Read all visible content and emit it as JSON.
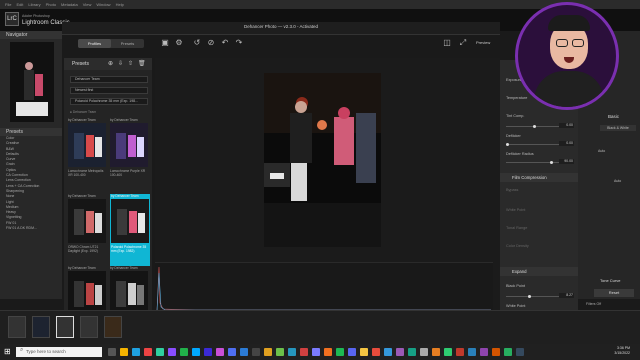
{
  "menubar": {
    "items": [
      "File",
      "Edit",
      "Library",
      "Photo",
      "Metadata",
      "View",
      "Window",
      "Help"
    ]
  },
  "app": {
    "name": "Lightroom Classic",
    "brand": "Adobe Photoshop",
    "logo": "LrC"
  },
  "left_panel": {
    "navigator_label": "Navigator",
    "presets_label": "Presets",
    "tree": [
      "Color",
      "Creative",
      "B&W",
      "Defaults",
      "Curve",
      "Grain",
      "Optics",
      "CA Correction",
      "Lens Correction",
      "Lens + CA Correction",
      "Sharpening",
      "None",
      "Light",
      "Medium",
      "Heavy",
      "Vignetting",
      "FW 01",
      "FW 01 A DK RDM..."
    ],
    "copy_label": "Copy...",
    "paste_label": "Paste"
  },
  "plugin": {
    "title": "Dehancer Photo — v2.3.0 - Activated",
    "tabs": [
      "Profiles",
      "Presets"
    ],
    "presets_header": "Presets",
    "filter_selects": [
      "Dehancer Team",
      "Newest first",
      "Polaroid Polachrome 35 mm (Exp. 198..."
    ],
    "list_label_top": "● Dehancer Team",
    "thumbs": [
      {
        "author": "by Dehancer Team",
        "name": "Lomochrome Metropolis XR 100-400"
      },
      {
        "author": "by Dehancer Team",
        "name": "Lomochrome Purple XR 100-400"
      },
      {
        "author": "by Dehancer Team",
        "name": "ORWO Chrom UT21 Daylight (Exp. 1992)"
      },
      {
        "author": "by Dehancer Team",
        "name": "Polaroid Polachrome 35 mm (Exp. 1982)"
      },
      {
        "author": "by Dehancer Team",
        "name": ""
      },
      {
        "author": "by Dehancer Team",
        "name": ""
      }
    ],
    "preview_label": "Preview"
  },
  "right_panel": {
    "rows_top": [
      {
        "label": "Exposure",
        "value": ""
      },
      {
        "label": "Temperature",
        "value": ""
      },
      {
        "label": "Tint Comp.",
        "value": "0.00"
      },
      {
        "label": "Deflicker",
        "value": "0.00"
      },
      {
        "label": "Deflicker Radius",
        "value": "90.00"
      }
    ],
    "film_compression": "Film Compression",
    "fc_rows": [
      "Bypass",
      "White Point",
      "Tonal Range",
      "Color Density"
    ],
    "expand": "Expand",
    "expand_rows": [
      {
        "label": "Black Point",
        "value": "8.27"
      },
      {
        "label": "White Point",
        "value": "0.00"
      }
    ]
  },
  "far_right": {
    "basic": "Basic",
    "auto": "Auto",
    "black_white": "Black & White",
    "tone_curve": "Tone Curve",
    "reset": "Reset",
    "filters_off": "Filters Off",
    "color": "Color"
  },
  "taskbar": {
    "search_placeholder": "Type here to search",
    "time": "3:36 PM",
    "date": "3/15/2022"
  },
  "colors": {
    "accent_cyan": "#10b6d4",
    "highlight_border": "#7a2fb0"
  }
}
